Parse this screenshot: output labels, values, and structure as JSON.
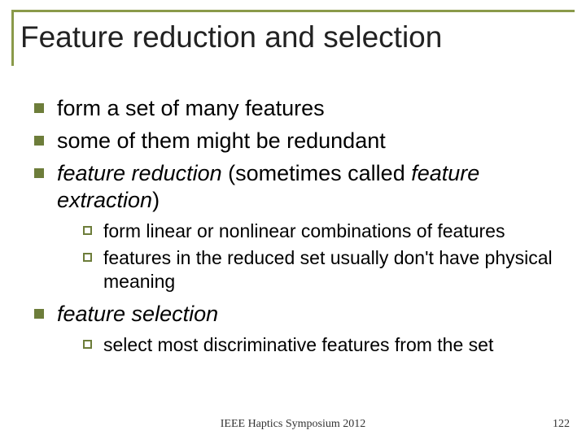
{
  "title": "Feature reduction and selection",
  "bullets": {
    "b0": "form a set of many features",
    "b1": "some of them might be redundant",
    "b2_pre": "feature reduction",
    "b2_mid": " (sometimes called ",
    "b2_italic2": "feature extraction",
    "b2_post": ")",
    "b3": "feature selection"
  },
  "sub1": {
    "s0": "form linear or nonlinear combinations of features",
    "s1": "features in the reduced set usually don't have physical meaning"
  },
  "sub2": {
    "s0": "select most discriminative features from the set"
  },
  "footer": {
    "center": "IEEE Haptics Symposium 2012",
    "page": "122"
  }
}
